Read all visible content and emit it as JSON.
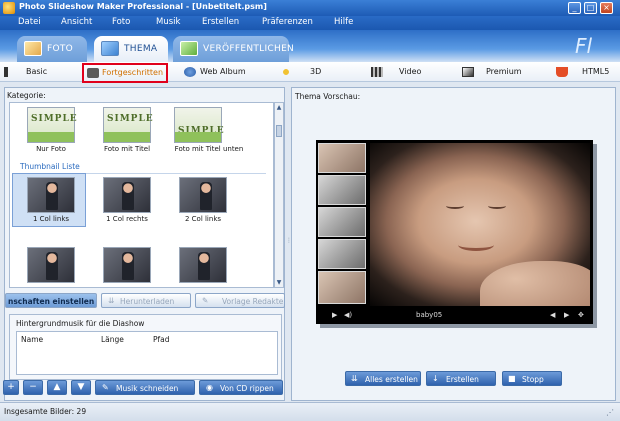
{
  "window": {
    "title": "Photo Slideshow Maker Professional - [Unbetitelt.psm]",
    "minimize": "_",
    "maximize": "□",
    "close": "×"
  },
  "menu": [
    "Datei",
    "Ansicht",
    "Foto",
    "Musik",
    "Erstellen",
    "Präferenzen",
    "Hilfe"
  ],
  "main_tabs": [
    {
      "label": "FOTO",
      "icon": "photo-icon",
      "active": false
    },
    {
      "label": "THEMA",
      "icon": "theme-icon",
      "active": true
    },
    {
      "label": "VERÖFFENTLICHEN",
      "icon": "publish-icon",
      "active": false
    }
  ],
  "logo_fragment": "Fl",
  "sub_tabs": [
    {
      "label": "Basic",
      "icon": "basic-icon"
    },
    {
      "label": "Fortgeschritten",
      "icon": "camera-icon",
      "active": true
    },
    {
      "label": "Web Album",
      "icon": "globe-icon"
    },
    {
      "label": "3D",
      "icon": "3d-icon"
    },
    {
      "label": "Video",
      "icon": "film-icon"
    },
    {
      "label": "Premium",
      "icon": "premium-icon"
    },
    {
      "label": "HTML5",
      "icon": "html5-icon"
    }
  ],
  "left": {
    "category_label": "Kategorie:",
    "simple_row": [
      {
        "caption": "Nur Foto",
        "word": "SIMPLE"
      },
      {
        "caption": "Foto mit Titel",
        "word": "SIMPLE"
      },
      {
        "caption": "Foto mit Titel unten",
        "word": "SIMPLE"
      }
    ],
    "thumbnail_header": "Thumbnail Liste",
    "thumb_row": [
      {
        "caption": "1 Col links",
        "selected": true
      },
      {
        "caption": "1 Col rechts",
        "selected": false
      },
      {
        "caption": "2 Col links",
        "selected": false
      }
    ],
    "buttons": {
      "properties": "nschaften einstellen",
      "download": "Herunterladen",
      "template": "Vorlage Redakte"
    },
    "music": {
      "label": "Hintergrundmusik für die Diashow",
      "col_name": "Name",
      "col_length": "Länge",
      "col_path": "Pfad",
      "cut_button": "Musik schneiden",
      "rip_button": "Von CD rippen"
    }
  },
  "right": {
    "preview_label": "Thema Vorschau:",
    "caption": "baby05",
    "buttons": {
      "create_all": "Alles erstellen",
      "create": "Erstellen",
      "stop": "Stopp"
    }
  },
  "status": {
    "text": "Insgesamte Bilder: 29"
  },
  "colors": {
    "title_blue": "#1d5bb5",
    "highlight_red": "#e0001b",
    "accent_orange": "#d07000"
  }
}
